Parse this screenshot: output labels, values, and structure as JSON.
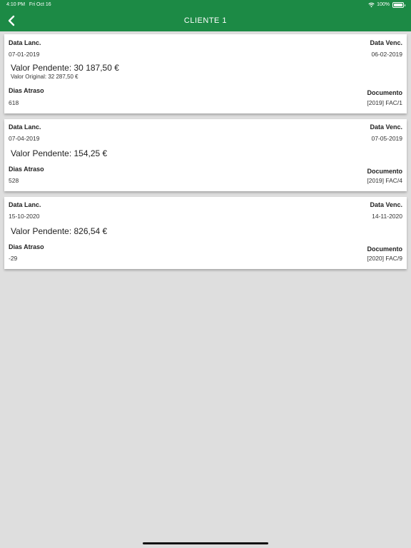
{
  "status": {
    "time": "4:10 PM",
    "date": "Fri Oct 16",
    "battery": "100%"
  },
  "header": {
    "title": "CLIENTE 1"
  },
  "labels": {
    "data_lanc": "Data Lanc.",
    "data_venc": "Data Venc.",
    "dias_atraso": "Dias Atraso",
    "documento": "Documento"
  },
  "cards": [
    {
      "data_lanc": "07-01-2019",
      "data_venc": "06-02-2019",
      "valor_pendente": "Valor Pendente: 30 187,50 €",
      "valor_original": "Valor Original: 32 287,50 €",
      "dias_atraso": "618",
      "documento": "[2019] FAC/1"
    },
    {
      "data_lanc": "07-04-2019",
      "data_venc": "07-05-2019",
      "valor_pendente": "Valor Pendente: 154,25 €",
      "dias_atraso": "528",
      "documento": "[2019] FAC/4"
    },
    {
      "data_lanc": "15-10-2020",
      "data_venc": "14-11-2020",
      "valor_pendente": "Valor Pendente: 826,54 €",
      "dias_atraso": "-29",
      "documento": "[2020] FAC/9"
    }
  ],
  "colors": {
    "header_bg": "#1c8a45",
    "page_bg": "#dedede",
    "card_bg": "#ffffff"
  }
}
